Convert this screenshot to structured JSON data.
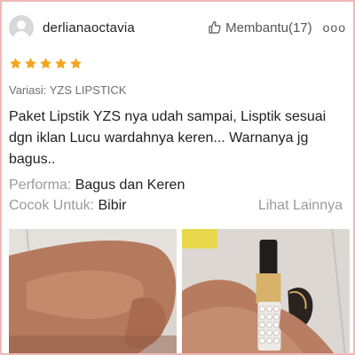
{
  "review": {
    "username": "derlianaoctavia",
    "helpful_label": "Membantu(17)",
    "more_label": "ooo",
    "rating": 5,
    "star_color": "#f3a51e",
    "variant": "Variasi: YZS LIPSTICK",
    "text": "Paket Lipstik YZS nya udah sampai, Lisptik sesuai dgn iklan Lucu wardahnya keren... Warnanya jg bagus..",
    "performance_key": "Performa:",
    "performance_value": "Bagus dan Keren",
    "suitable_key": "Cocok Untuk:",
    "suitable_value": "Bibir",
    "see_more": "Lihat Lainnya"
  },
  "icons": {
    "avatar": "user-avatar-icon",
    "helpful": "thumbs-up-icon",
    "more": "more-options-icon",
    "star": "star-icon"
  }
}
